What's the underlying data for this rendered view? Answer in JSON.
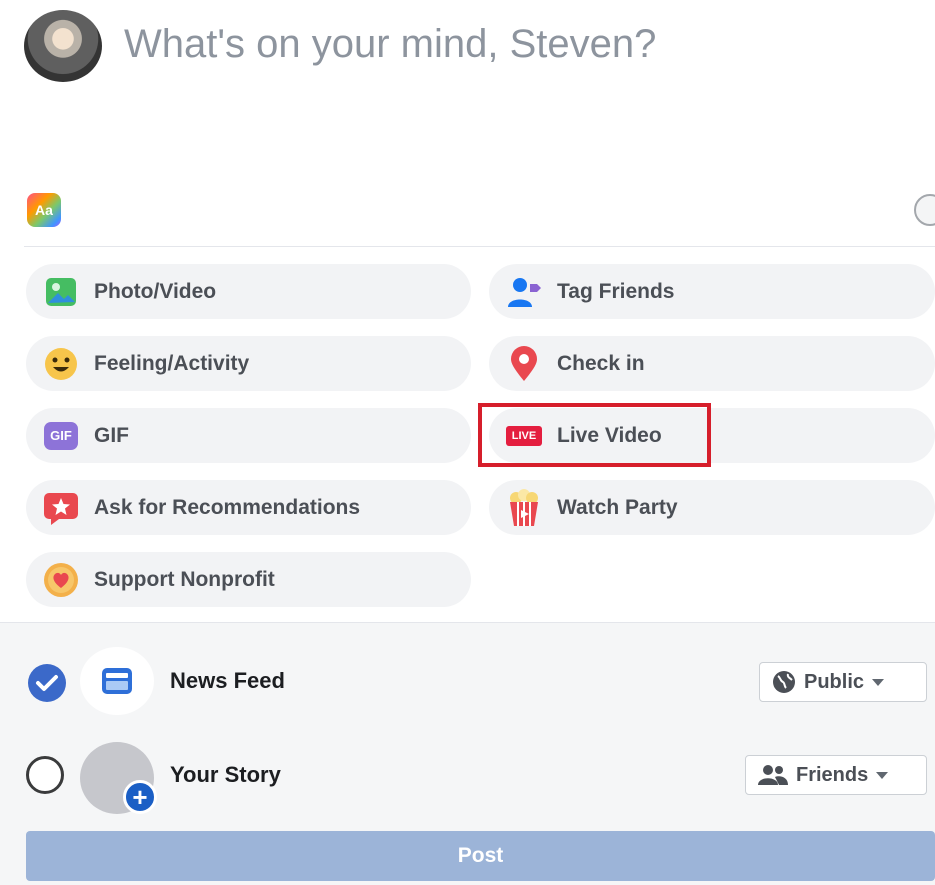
{
  "composer": {
    "placeholder": "What's on your mind, Steven?",
    "text_format_icon_text": "Aa"
  },
  "options": [
    {
      "label": "Photo/Video",
      "icon": "photo-icon"
    },
    {
      "label": "Tag Friends",
      "icon": "tag-friends-icon"
    },
    {
      "label": "Feeling/Activity",
      "icon": "feeling-icon"
    },
    {
      "label": "Check in",
      "icon": "location-pin-icon"
    },
    {
      "label": "GIF",
      "icon": "gif-icon"
    },
    {
      "label": "Live Video",
      "icon": "live-video-icon"
    },
    {
      "label": "Ask for Recommendations",
      "icon": "recommendations-icon"
    },
    {
      "label": "Watch Party",
      "icon": "watch-party-icon"
    },
    {
      "label": "Support Nonprofit",
      "icon": "nonprofit-icon"
    }
  ],
  "icon_text": {
    "gif": "GIF",
    "live": "LIVE"
  },
  "destinations": {
    "news_feed": {
      "label": "News Feed",
      "privacy": "Public",
      "checked": true
    },
    "your_story": {
      "label": "Your Story",
      "privacy": "Friends",
      "checked": false
    }
  },
  "post_button": "Post",
  "colors": {
    "accent": "#3b69c9",
    "highlight": "#d61e2b",
    "post_button": "#9cb4d8"
  }
}
